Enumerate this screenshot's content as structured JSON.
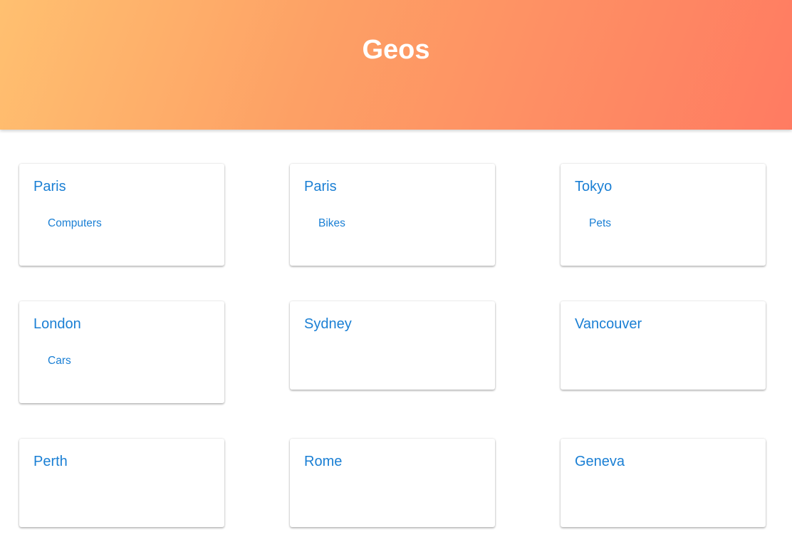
{
  "header": {
    "title": "Geos"
  },
  "geos": [
    {
      "name": "Paris",
      "items": [
        "Computers"
      ]
    },
    {
      "name": "Paris",
      "items": [
        "Bikes"
      ]
    },
    {
      "name": "Tokyo",
      "items": [
        "Pets"
      ]
    },
    {
      "name": "London",
      "items": [
        "Cars"
      ]
    },
    {
      "name": "Sydney",
      "items": []
    },
    {
      "name": "Vancouver",
      "items": []
    },
    {
      "name": "Perth",
      "items": []
    },
    {
      "name": "Rome",
      "items": []
    },
    {
      "name": "Geneva",
      "items": []
    }
  ],
  "colors": {
    "link": "#1a7fd4",
    "gradient_start": "#ffc070",
    "gradient_end": "#ff7b62"
  }
}
